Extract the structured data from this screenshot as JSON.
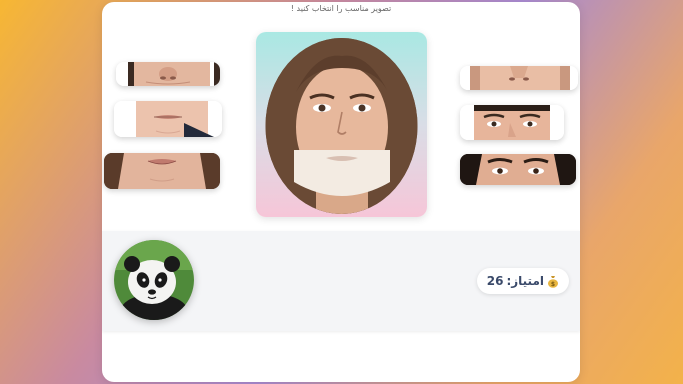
{
  "game": {
    "instruction": "تصویر مناسب را انتخاب کنید !",
    "score": {
      "label": "امتیاز:",
      "value": "26",
      "icon": "money-bag-icon"
    },
    "left_strips": [
      {
        "name": "eyes-nose-strip"
      },
      {
        "name": "mouth-strip"
      },
      {
        "name": "lips-strip"
      }
    ],
    "right_strips": [
      {
        "name": "chin-strip"
      },
      {
        "name": "eyes-strip"
      },
      {
        "name": "eyes-brows-strip"
      }
    ],
    "colors": {
      "panel_top": "#a9e8e3",
      "panel_bottom": "#f6c6d8",
      "text": "#3a4a6a"
    }
  }
}
